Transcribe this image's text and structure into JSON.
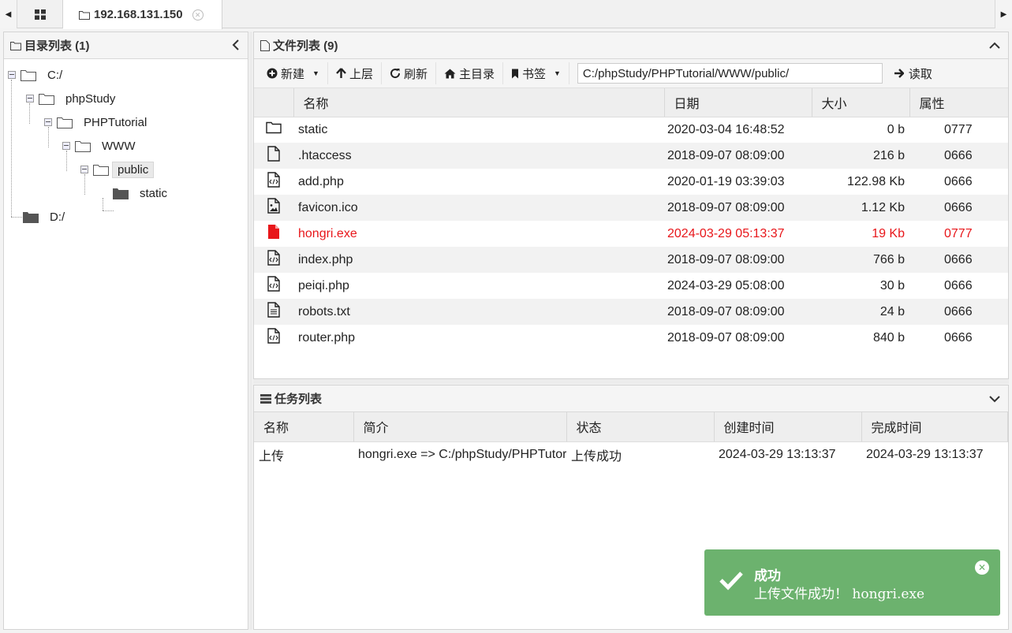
{
  "tabbar": {
    "connection_label": "192.168.131.150"
  },
  "dir_panel": {
    "title": "目录列表 (1)",
    "tree": {
      "c": "C:/",
      "phpstudy": "phpStudy",
      "phptutorial": "PHPTutorial",
      "www": "WWW",
      "public": "public",
      "static": "static",
      "d": "D:/"
    }
  },
  "file_panel": {
    "title": "文件列表 (9)",
    "toolbar": {
      "new": "新建",
      "up": "上层",
      "refresh": "刷新",
      "home": "主目录",
      "bookmark": "书签",
      "path": "C:/phpStudy/PHPTutorial/WWW/public/",
      "read": "读取"
    },
    "columns": {
      "name": "名称",
      "date": "日期",
      "size": "大小",
      "attr": "属性"
    },
    "files": [
      {
        "icon": "folder-icon",
        "name": "static",
        "date": "2020-03-04 16:48:52",
        "size": "0 b",
        "attr": "0777"
      },
      {
        "icon": "file-icon",
        "name": ".htaccess",
        "date": "2018-09-07 08:09:00",
        "size": "216 b",
        "attr": "0666"
      },
      {
        "icon": "code-file-icon",
        "name": "add.php",
        "date": "2020-01-19 03:39:03",
        "size": "122.98 Kb",
        "attr": "0666"
      },
      {
        "icon": "image-file-icon",
        "name": "favicon.ico",
        "date": "2018-09-07 08:09:00",
        "size": "1.12 Kb",
        "attr": "0666"
      },
      {
        "icon": "file-icon",
        "name": "hongri.exe",
        "date": "2024-03-29 05:13:37",
        "size": "19 Kb",
        "attr": "0777"
      },
      {
        "icon": "code-file-icon",
        "name": "index.php",
        "date": "2018-09-07 08:09:00",
        "size": "766 b",
        "attr": "0666"
      },
      {
        "icon": "code-file-icon",
        "name": "peiqi.php",
        "date": "2024-03-29 05:08:00",
        "size": "30 b",
        "attr": "0666"
      },
      {
        "icon": "text-file-icon",
        "name": "robots.txt",
        "date": "2018-09-07 08:09:00",
        "size": "24 b",
        "attr": "0666"
      },
      {
        "icon": "code-file-icon",
        "name": "router.php",
        "date": "2018-09-07 08:09:00",
        "size": "840 b",
        "attr": "0666"
      }
    ],
    "highlight_color": "#e8161a"
  },
  "task_panel": {
    "title": "任务列表",
    "columns": {
      "name": "名称",
      "desc": "简介",
      "status": "状态",
      "created": "创建时间",
      "finished": "完成时间"
    },
    "tasks": [
      {
        "name": "上传",
        "desc": "hongri.exe => C:/phpStudy/PHPTutorial/WWW/public/",
        "status": "上传成功",
        "created": "2024-03-29 13:13:37",
        "finished": "2024-03-29 13:13:37"
      }
    ]
  },
  "toast": {
    "title": "成功",
    "message": "上传文件成功！ hongri.exe",
    "color": "#6cb26e"
  }
}
